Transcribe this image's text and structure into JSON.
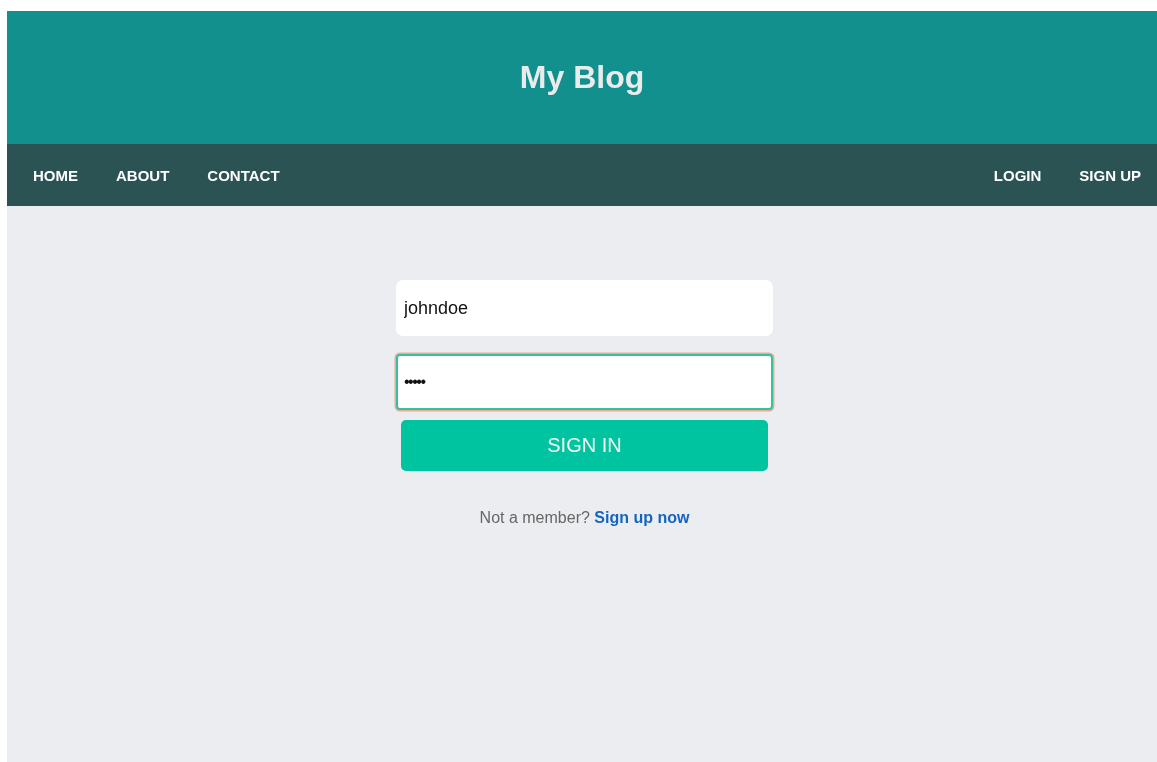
{
  "header": {
    "title": "My Blog"
  },
  "nav": {
    "left": [
      {
        "label": "HOME"
      },
      {
        "label": "ABOUT"
      },
      {
        "label": "CONTACT"
      }
    ],
    "right": [
      {
        "label": "LOGIN"
      },
      {
        "label": "SIGN UP"
      }
    ]
  },
  "form": {
    "fields": [
      {
        "kind": "text",
        "value": "johndoe",
        "focused": false
      },
      {
        "kind": "password",
        "value": "•••••",
        "focused": true
      }
    ],
    "button": "SIGN IN",
    "prompt": "Not a member?",
    "link": "Sign up now"
  }
}
